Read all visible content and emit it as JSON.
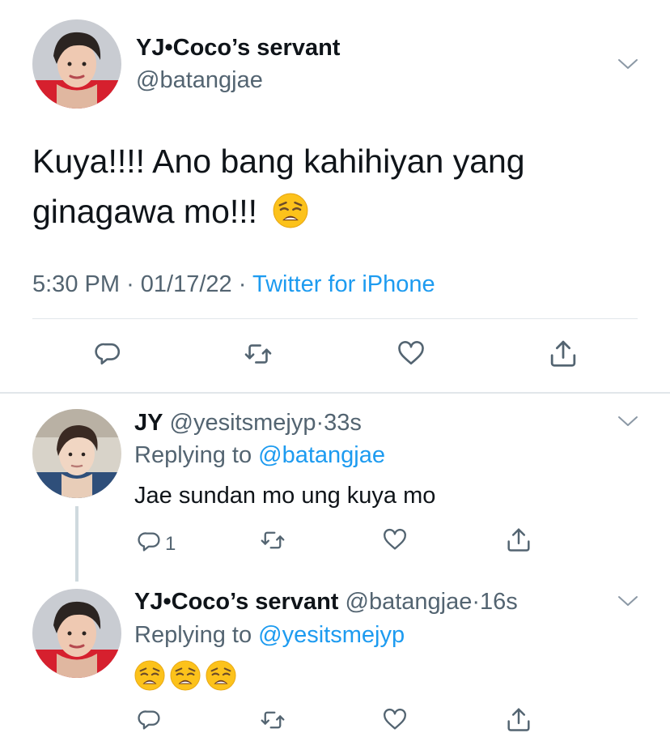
{
  "main_tweet": {
    "display_name": "YJ•Coco’s servant",
    "handle": "@batangjae",
    "text": "Kuya!!!! Ano bang kahihiyan yang ginagawa mo!!!",
    "emoji": "weary-face",
    "time": "5:30 PM",
    "date": "01/17/22",
    "source": "Twitter for iPhone"
  },
  "replies": [
    {
      "display_name": "JY",
      "handle": "@yesitsmejyp",
      "age": "33s",
      "replying_label": "Replying to",
      "replying_to": "@batangjae",
      "text": "Jae sundan mo ung kuya mo",
      "reply_count": "1"
    },
    {
      "display_name": "YJ•Coco’s servant",
      "handle": "@batangjae",
      "age": "16s",
      "replying_label": "Replying to",
      "replying_to": "@yesitsmejyp",
      "emoji_count": 3,
      "emoji": "weary-face"
    }
  ],
  "separator": "·",
  "colors": {
    "link": "#1d9bf0",
    "muted": "#536471",
    "text": "#0f1419",
    "icon": "#536471"
  }
}
